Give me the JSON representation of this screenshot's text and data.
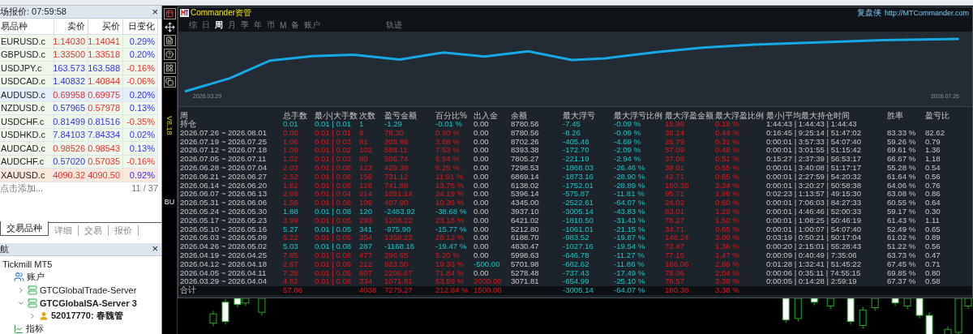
{
  "market_watch": {
    "title": "场报价: 07:59:58",
    "close": "×",
    "columns": [
      "易品种",
      "卖价",
      "买价",
      "日变化"
    ],
    "rows": [
      {
        "symbol": "EURUSD.c",
        "bid": "1.14030",
        "ask": "1.14041",
        "change": "0.29%",
        "bid_up": false,
        "ask_up": false,
        "change_up": true,
        "selected": false,
        "kind": "currency"
      },
      {
        "symbol": "GBPUSD.c",
        "bid": "1.33500",
        "ask": "1.33518",
        "change": "0.20%",
        "bid_up": false,
        "ask_up": false,
        "change_up": true,
        "selected": false,
        "kind": "currency"
      },
      {
        "symbol": "USDJPY.c",
        "bid": "163.573",
        "ask": "163.588",
        "change": "-0.16%",
        "bid_up": true,
        "ask_up": true,
        "change_up": false,
        "selected": false,
        "kind": "currency"
      },
      {
        "symbol": "USDCAD.c",
        "bid": "1.40832",
        "ask": "1.40844",
        "change": "-0.06%",
        "bid_up": true,
        "ask_up": false,
        "change_up": false,
        "selected": false,
        "kind": "currency"
      },
      {
        "symbol": "AUDUSD.c",
        "bid": "0.69958",
        "ask": "0.69975",
        "change": "0.20%",
        "bid_up": false,
        "ask_up": false,
        "change_up": true,
        "selected": true,
        "kind": "currency"
      },
      {
        "symbol": "NZDUSD.c",
        "bid": "0.57965",
        "ask": "0.57978",
        "change": "0.13%",
        "bid_up": true,
        "ask_up": false,
        "change_up": true,
        "selected": false,
        "kind": "currency"
      },
      {
        "symbol": "USDCHF.c",
        "bid": "0.81499",
        "ask": "0.81516",
        "change": "-0.35%",
        "bid_up": true,
        "ask_up": true,
        "change_up": false,
        "selected": false,
        "kind": "currency"
      },
      {
        "symbol": "USDHKD.c",
        "bid": "7.84103",
        "ask": "7.84334",
        "change": "0.02%",
        "bid_up": true,
        "ask_up": true,
        "change_up": true,
        "selected": false,
        "kind": "currency"
      },
      {
        "symbol": "AUDCAD.c",
        "bid": "0.98526",
        "ask": "0.98543",
        "change": "0.13%",
        "bid_up": false,
        "ask_up": false,
        "change_up": true,
        "selected": false,
        "kind": "currency"
      },
      {
        "symbol": "AUDCHF.c",
        "bid": "0.57020",
        "ask": "0.57035",
        "change": "-0.16%",
        "bid_up": true,
        "ask_up": false,
        "change_up": false,
        "selected": false,
        "kind": "currency"
      },
      {
        "symbol": "XAUUSD.c",
        "bid": "4090.32",
        "ask": "4090.50",
        "change": "0.92%",
        "bid_up": false,
        "ask_up": false,
        "change_up": true,
        "selected": false,
        "kind": "commodity"
      }
    ],
    "add_hint": "点击添加...",
    "count": "11 / 37",
    "tabs": [
      {
        "label": "交易品种",
        "selected": true
      },
      {
        "label": "详细",
        "selected": false
      },
      {
        "label": "交易",
        "selected": false
      },
      {
        "label": "报价",
        "selected": false
      }
    ]
  },
  "navigator": {
    "title": "航",
    "close": "×",
    "tree": [
      {
        "label": "Tickmill MT5",
        "children": [
          {
            "label": "账户",
            "kind": "accounts",
            "children": [
              {
                "label": "GTCGlobalTrade-Server",
                "kind": "server",
                "expanded": false,
                "active": false
              },
              {
                "label": "GTCGlobalSA-Server 3",
                "kind": "server",
                "expanded": true,
                "active": true,
                "children": [
                  {
                    "label": "52017770: 春魏管",
                    "kind": "user",
                    "expanded": false,
                    "active": true
                  }
                ]
              }
            ]
          },
          {
            "label": "指标",
            "kind": "indicators"
          }
        ]
      }
    ]
  },
  "side_strip": {
    "version": "V8.18",
    "order_label": "BU"
  },
  "commander": {
    "title": "Commander资管",
    "site_name": "复盘侠",
    "site_url": "http://MTCommander.com",
    "tabs": [
      {
        "label": "综",
        "selected": false
      },
      {
        "label": "日",
        "selected": false
      },
      {
        "label": "周",
        "selected": true
      },
      {
        "label": "月",
        "selected": false
      },
      {
        "label": "季",
        "selected": false
      },
      {
        "label": "年",
        "selected": false
      },
      {
        "label": "币",
        "selected": false
      },
      {
        "label": "M",
        "selected": false
      },
      {
        "label": "备",
        "selected": false
      },
      {
        "label": "账户",
        "selected": false
      }
    ],
    "track_tab": {
      "label": "轨迹",
      "selected": false
    },
    "equity_chart": {
      "start_date": "2026.03.29",
      "end_date": "2026.07.26"
    },
    "table": {
      "columns": [
        "周",
        "总手数",
        "最小|大手数",
        "次数",
        "盈亏金额",
        "百分比%",
        "出入金",
        "余额",
        "最大浮亏",
        "最大浮亏比例",
        "最大浮盈金额",
        "最大浮盈比例",
        "最小|平均最大持仓时间",
        "胜率",
        "盈亏比"
      ],
      "rows": [
        {
          "profit": false,
          "deposit": false,
          "withdrawal": false,
          "cells": [
            "持仓",
            "0.01",
            "0.01 | 0.01",
            "1",
            "-1.29",
            "-0.01 %",
            "0.00",
            "8780.56",
            "-7.45",
            "-0.09 %",
            "15.96",
            "0.18 %",
            "1:44:43 | 1:44:43 | 1:44:43",
            null,
            null
          ]
        },
        {
          "profit": true,
          "deposit": false,
          "withdrawal": false,
          "cells": [
            "2026.07.26 ~ 2026.08.01",
            "0.06",
            "0.01 | 0.01",
            "6",
            "78.30",
            "0.90 %",
            "0.00",
            "8780.56",
            "-8.26",
            "-0.09 %",
            "38.14",
            "0.44 %",
            "0:16:45 | 9:25:14 | 51:47:02",
            "83.33 %",
            "82.62"
          ]
        },
        {
          "profit": true,
          "deposit": false,
          "withdrawal": false,
          "cells": [
            "2026.07.19 ~ 2026.07.25",
            "1.06",
            "0.01 | 0.03",
            "81",
            "308.88",
            "3.68 %",
            "0.00",
            "8702.26",
            "-405.46",
            "-4.69 %",
            "26.79",
            "0.31 %",
            "0:00:01 | 3:57:33 | 54:07:40",
            "59.26 %",
            "0.79"
          ]
        },
        {
          "profit": true,
          "deposit": false,
          "withdrawal": false,
          "cells": [
            "2026.07.12 ~ 2026.07.18",
            "1.09",
            "0.01 | 0.02",
            "102",
            "588.11",
            "7.53 %",
            "0.00",
            "8393.38",
            "-172.70",
            "-2.09 %",
            "37.09",
            "0.48 %",
            "0:00:01 | 3:01:55 | 51:15:42",
            "69.61 %",
            "1.36"
          ]
        },
        {
          "profit": true,
          "deposit": false,
          "withdrawal": false,
          "cells": [
            "2026.07.05 ~ 2026.07.11",
            "1.02",
            "0.01 | 0.02",
            "90",
            "506.74",
            "6.94 %",
            "0.00",
            "7805.27",
            "-221.19",
            "-2.94 %",
            "37.08",
            "0.51 %",
            "0:15:27 | 2:37:39 | 56:53:17",
            "66.67 %",
            "1.18"
          ]
        },
        {
          "profit": true,
          "deposit": false,
          "withdrawal": false,
          "cells": [
            "2026.06.28 ~ 2026.07.04",
            "2.03",
            "0.01 | 0.08",
            "123",
            "429.39",
            "6.25 %",
            "0.00",
            "7298.53",
            "-1868.03",
            "-26.46 %",
            "39.01",
            "0.55 %",
            "0:00:01 | 3:40:08 | 51:17:17",
            "55.28 %",
            "0.54"
          ]
        },
        {
          "profit": true,
          "deposit": false,
          "withdrawal": false,
          "cells": [
            "2026.06.21 ~ 2026.06.27",
            "2.52",
            "0.01 | 0.08",
            "159",
            "731.12",
            "11.91 %",
            "0.00",
            "6869.14",
            "-1873.16",
            "-28.90 %",
            "42.71",
            "0.65 %",
            "0:00:01 | 2:27:59 | 54:20:32",
            "61.64 %",
            "0.56"
          ]
        },
        {
          "profit": true,
          "deposit": false,
          "withdrawal": false,
          "cells": [
            "2026.06.14 ~ 2026.06.20",
            "1.82",
            "0.01 | 0.08",
            "128",
            "741.88",
            "13.75 %",
            "0.00",
            "6138.02",
            "-1752.01",
            "-28.89 %",
            "180.38",
            "3.34 %",
            "0:00:01 | 3:20:27 | 50:58:38",
            "64.06 %",
            "0.76"
          ]
        },
        {
          "profit": true,
          "deposit": false,
          "withdrawal": false,
          "cells": [
            "2026.06.07 ~ 2026.06.13",
            "2.68",
            "0.01 | 0.04",
            "214",
            "1051.14",
            "24.19 %",
            "0.00",
            "5396.14",
            "-575.87",
            "-11.81 %",
            "95.71",
            "1.96 %",
            "0:02:23 | 1:13:57 | 49:15:30",
            "63.08 %",
            "0.86"
          ]
        },
        {
          "profit": true,
          "deposit": false,
          "withdrawal": false,
          "cells": [
            "2026.05.31 ~ 2026.06.06",
            "1.56",
            "0.01 | 0.08",
            "109",
            "407.90",
            "10.36 %",
            "0.00",
            "4345.00",
            "-2522.61",
            "-64.07 %",
            "24.02",
            "0.60 %",
            "0:00:01 | 7:06:03 | 84:27:33",
            "60.55 %",
            "0.64"
          ]
        },
        {
          "profit": false,
          "deposit": false,
          "withdrawal": false,
          "cells": [
            "2026.05.24 ~ 2026.05.30",
            "1.88",
            "0.01 | 0.08",
            "120",
            "-2483.92",
            "-38.68 %",
            "0.00",
            "3937.10",
            "-3005.14",
            "-43.83 %",
            "83.01",
            "1.29 %",
            "0:00:01 | 4:46:46 | 52:00:33",
            "59.17 %",
            "0.30"
          ]
        },
        {
          "profit": true,
          "deposit": false,
          "withdrawal": false,
          "cells": [
            "2026.05.17 ~ 2026.05.23",
            "3.99",
            "0.01 | 0.05",
            "293",
            "1208.22",
            "23.18 %",
            "0.00",
            "6421.02",
            "-1810.50",
            "-31.43 %",
            "78.27",
            "1.50 %",
            "0:00:01 | 1:08:25 | 50:46:19",
            "61.43 %",
            "1.11"
          ]
        },
        {
          "profit": false,
          "deposit": false,
          "withdrawal": false,
          "cells": [
            "2026.05.10 ~ 2026.05.16",
            "5.27",
            "0.01 | 0.05",
            "341",
            "-975.90",
            "-15.77 %",
            "0.00",
            "5212.80",
            "-1061.01",
            "-21.15 %",
            "34.71",
            "0.65 %",
            "0:00:01 | 1:00:07 | 54:07:40",
            "52.49 %",
            "0.65"
          ]
        },
        {
          "profit": true,
          "deposit": false,
          "withdrawal": false,
          "cells": [
            "2026.05.03 ~ 2026.05.09",
            "5.22",
            "0.01 | 0.05",
            "354",
            "1358.23",
            "28.12 %",
            "0.00",
            "6188.70",
            "-983.52",
            "-19.87 %",
            "148.24",
            "3.00 %",
            "0:03:19 | 0:50:21 | 50:17:04",
            "61.02 %",
            "0.89"
          ]
        },
        {
          "profit": false,
          "deposit": false,
          "withdrawal": false,
          "cells": [
            "2026.04.26 ~ 2026.05.02",
            "5.03",
            "0.01 | 0.08",
            "287",
            "-1168.16",
            "-19.47 %",
            "0.00",
            "4830.47",
            "-1027.16",
            "-19.54 %",
            "73.47",
            "1.36 %",
            "0:00:20 | 2:15:01 | 55:28:43",
            "51.22 %",
            "0.56"
          ]
        },
        {
          "profit": true,
          "deposit": false,
          "withdrawal": false,
          "cells": [
            "2026.04.19 ~ 2026.04.25",
            "7.85",
            "0.01 | 0.08",
            "477",
            "296.65",
            "5.20 %",
            "0.00",
            "5998.63",
            "-646.78",
            "-11.27 %",
            "77.15",
            "1.47 %",
            "0:00:09 | 0:40:49 | 7:35:06",
            "63.73 %",
            "0.47"
          ]
        },
        {
          "profit": true,
          "deposit": false,
          "withdrawal": true,
          "cells": [
            "2026.04.12 ~ 2026.04.18",
            "2.67",
            "0.01 | 0.05",
            "212",
            "923.50",
            "19.33 %",
            "-500.00",
            "5701.98",
            "-662.62",
            "-11.86 %",
            "166.06",
            "2.89 %",
            "0:01:28 | 1:32:41 | 51:45:22",
            "67.45 %",
            "0.71"
          ]
        },
        {
          "profit": true,
          "deposit": false,
          "withdrawal": false,
          "cells": [
            "2026.04.05 ~ 2026.04.11",
            "7.28",
            "0.01 | 0.05",
            "607",
            "2206.67",
            "71.84 %",
            "0.00",
            "5278.48",
            "-737.43",
            "-17.49 %",
            "78.06",
            "2.04 %",
            "0:00:06 | 0:35:11 | 74:55:15",
            "69.85 %",
            "0.80"
          ]
        },
        {
          "profit": true,
          "deposit": true,
          "withdrawal": false,
          "cells": [
            "2026.03.29 ~ 2026.04.04",
            "4.82",
            "0.01 | 0.08",
            "334",
            "1071.81",
            "53.59 %",
            "2000.00",
            "3071.81",
            "-654.99",
            "-25.10 %",
            "76.57",
            "3.38 %",
            "0:00:05 | 0:14:28 | 2:59:19",
            "67.37 %",
            "0.58"
          ]
        }
      ],
      "total": {
        "profit": true,
        "deposit": true,
        "withdrawal": false,
        "cells": [
          "合计",
          "57.86",
          null,
          "4038",
          "7279.27",
          "212.84 %",
          "1500.00",
          null,
          "-3005.14",
          "-64.07 %",
          "180.38",
          "3.38 %",
          null,
          null,
          null
        ]
      }
    }
  }
}
